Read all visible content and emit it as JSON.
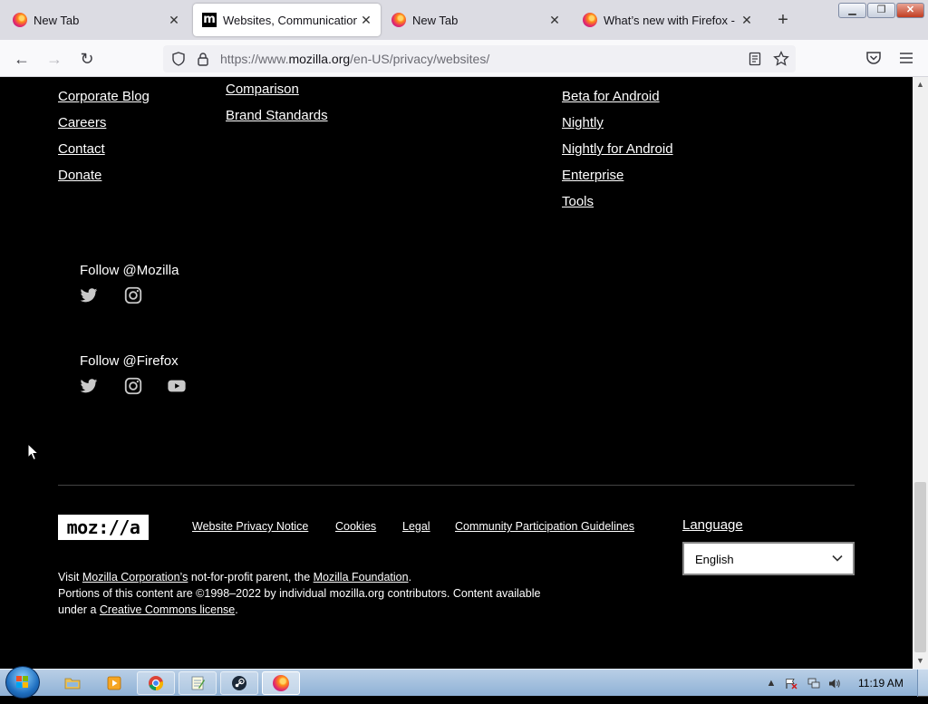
{
  "tabs": [
    {
      "title": "New Tab",
      "icon": "firefox-icon",
      "active": false
    },
    {
      "title": "Websites, Communications & Cookies Privacy Notice",
      "icon": "mozilla-m-icon",
      "active": true
    },
    {
      "title": "New Tab",
      "icon": "firefox-icon",
      "active": false
    },
    {
      "title": "What’s new with Firefox - Mozilla",
      "icon": "firefox-icon",
      "active": false
    }
  ],
  "tab_close_glyph": "✕",
  "new_tab_glyph": "+",
  "window_controls": {
    "minimize": "▁",
    "maximize": "❐",
    "close": "✕"
  },
  "nav": {
    "back_glyph": "←",
    "forward_glyph": "→",
    "reload_glyph": "↻",
    "url_prefix": "https://www.",
    "url_host": "mozilla.org",
    "url_path": "/en-US/privacy/websites/"
  },
  "footer": {
    "col1_links": [
      "Corporate Blog",
      "Careers",
      "Contact",
      "Donate"
    ],
    "col2_links": [
      "Comparison",
      "Brand Standards"
    ],
    "col3_links": [
      "Beta for Android",
      "Nightly",
      "Nightly for Android",
      "Enterprise",
      "Tools"
    ],
    "follow_mozilla": "Follow @Mozilla",
    "follow_firefox": "Follow @Firefox",
    "logo_text": "moz://a",
    "legal_links": [
      "Website Privacy Notice",
      "Cookies",
      "Legal",
      "Community Participation Guidelines"
    ],
    "language_label": "Language",
    "language_value": "English",
    "fine_print": {
      "visit": "Visit ",
      "corp_link": "Mozilla Corporation’s",
      "mid": " not-for-profit parent, the ",
      "foundation_link": "Mozilla Foundation",
      "end": ".",
      "portions": "Portions of this content are ©1998–2022 by individual mozilla.org contributors. Content available",
      "under": "under a ",
      "cc_link": "Creative Commons license",
      "dot": "."
    }
  },
  "taskbar": {
    "clock": "11:19 AM",
    "items": [
      "explorer-icon",
      "media-player-icon",
      "chrome-icon",
      "notepad-icon",
      "steam-icon",
      "firefox-icon"
    ]
  },
  "colors": {
    "page_bg": "#000000",
    "link": "#ffffff",
    "tabstrip": "#dcdce3"
  }
}
